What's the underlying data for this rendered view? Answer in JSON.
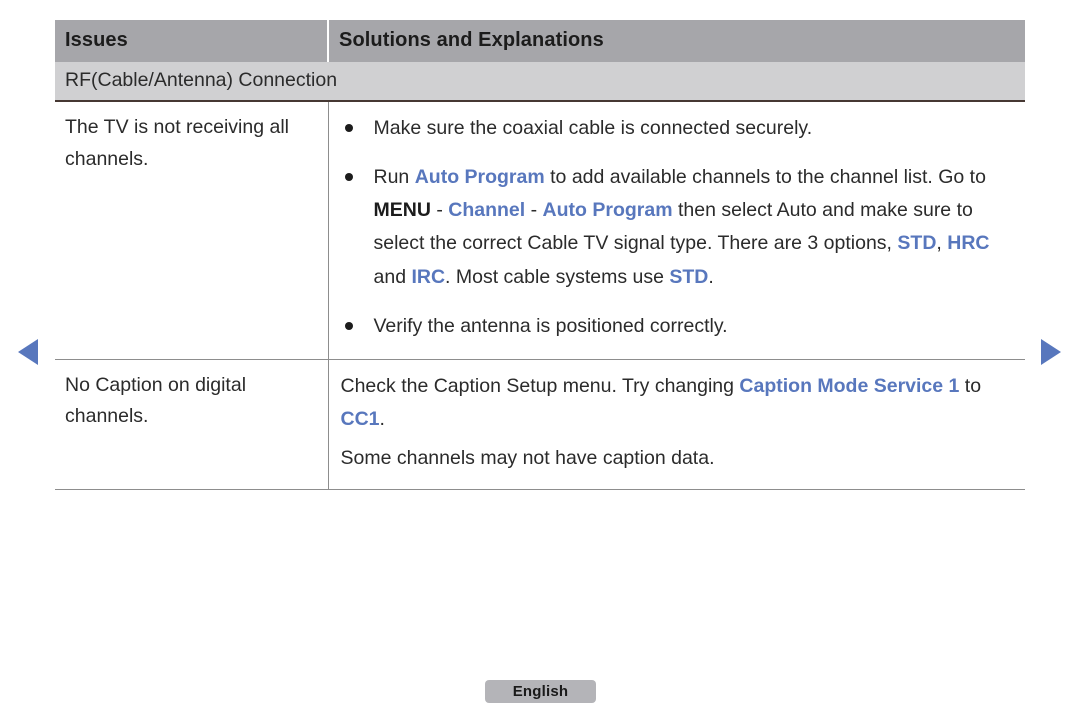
{
  "nav": {
    "prev_label": "previous page",
    "next_label": "next page"
  },
  "table": {
    "headers": {
      "issues": "Issues",
      "solutions": "Solutions and Explanations"
    },
    "section_title": "RF(Cable/Antenna) Connection",
    "rows": [
      {
        "issue": "The TV is not receiving all channels.",
        "bullets": [
          {
            "segments": [
              {
                "text": "Make sure the coaxial cable is connected securely.",
                "style": "plain"
              }
            ]
          },
          {
            "segments": [
              {
                "text": "Run ",
                "style": "plain"
              },
              {
                "text": "Auto Program",
                "style": "blue"
              },
              {
                "text": " to add available channels to the channel list. Go to ",
                "style": "plain"
              },
              {
                "text": "MENU",
                "style": "bold-dark"
              },
              {
                "text": " - ",
                "style": "plain"
              },
              {
                "text": "Channel",
                "style": "blue"
              },
              {
                "text": " - ",
                "style": "plain"
              },
              {
                "text": "Auto Program",
                "style": "blue"
              },
              {
                "text": " then select Auto and make sure to select the correct Cable TV signal type. There are 3 options, ",
                "style": "plain"
              },
              {
                "text": "STD",
                "style": "blue"
              },
              {
                "text": ", ",
                "style": "plain"
              },
              {
                "text": "HRC",
                "style": "blue"
              },
              {
                "text": " and ",
                "style": "plain"
              },
              {
                "text": "IRC",
                "style": "blue"
              },
              {
                "text": ". Most cable systems use ",
                "style": "plain"
              },
              {
                "text": "STD",
                "style": "blue"
              },
              {
                "text": ".",
                "style": "plain"
              }
            ]
          },
          {
            "segments": [
              {
                "text": "Verify the antenna is positioned correctly.",
                "style": "plain"
              }
            ]
          }
        ]
      },
      {
        "issue": "No Caption on digital channels.",
        "paragraphs": [
          {
            "segments": [
              {
                "text": "Check the Caption Setup menu. Try changing ",
                "style": "plain"
              },
              {
                "text": "Caption Mode Service 1",
                "style": "blue"
              },
              {
                "text": " to ",
                "style": "plain"
              },
              {
                "text": "CC1",
                "style": "blue"
              },
              {
                "text": ".",
                "style": "plain"
              }
            ]
          },
          {
            "segments": [
              {
                "text": "Some channels may not have caption data.",
                "style": "plain"
              }
            ]
          }
        ]
      }
    ]
  },
  "footer": {
    "language": "English"
  },
  "colors": {
    "accent_blue": "#5877bd",
    "header_gray": "#a6a6aa",
    "subheader_gray": "#d0d0d2",
    "section_rule": "#463833",
    "chip_gray": "#b4b4b8"
  }
}
